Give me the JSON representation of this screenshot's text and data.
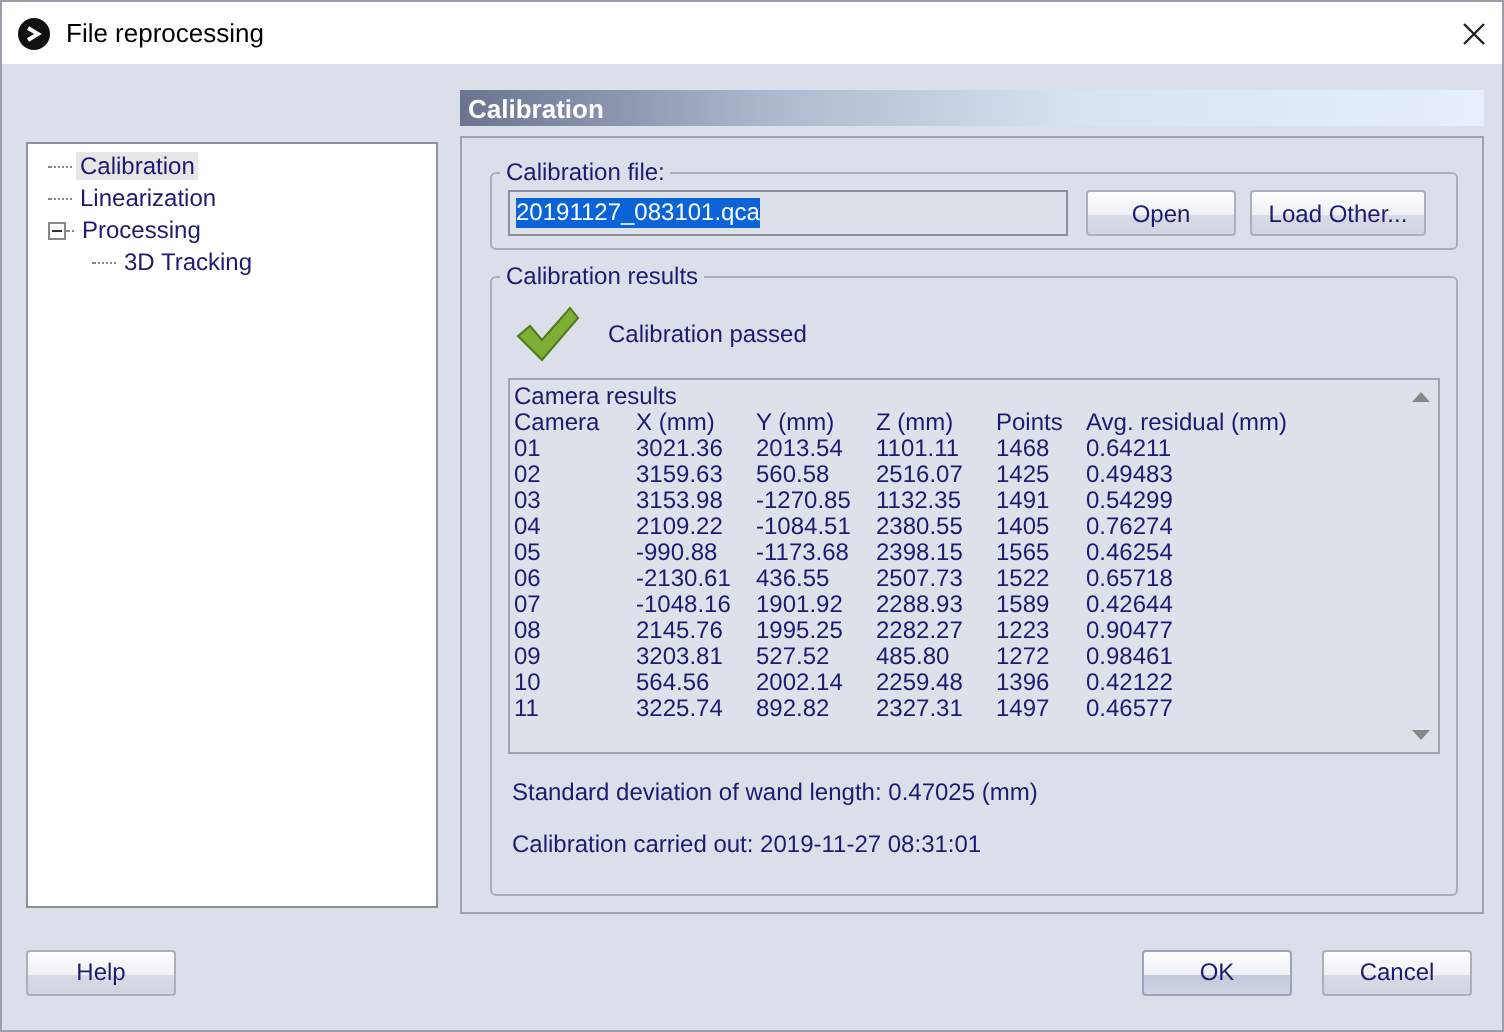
{
  "window": {
    "title": "File reprocessing"
  },
  "tree": [
    {
      "label": "Calibration",
      "selected": true
    },
    {
      "label": "Linearization",
      "selected": false
    },
    {
      "label": "Processing",
      "selected": false,
      "expanded": true,
      "children": [
        {
          "label": "3D Tracking",
          "selected": false
        }
      ]
    }
  ],
  "section_title": "Calibration",
  "calibration_file": {
    "legend": "Calibration file:",
    "value": "20191127_083101.qca",
    "buttons": [
      "Open",
      "Load Other..."
    ]
  },
  "results": {
    "legend": "Calibration results",
    "status": "Calibration passed",
    "passed": true,
    "list_title": "Camera results",
    "columns": [
      "Camera",
      "X (mm)",
      "Y (mm)",
      "Z (mm)",
      "Points",
      "Avg. residual (mm)"
    ],
    "rows": [
      [
        "01",
        "3021.36",
        "2013.54",
        "1101.11",
        "1468",
        "0.64211"
      ],
      [
        "02",
        "3159.63",
        "560.58",
        "2516.07",
        "1425",
        "0.49483"
      ],
      [
        "03",
        "3153.98",
        "-1270.85",
        "1132.35",
        "1491",
        "0.54299"
      ],
      [
        "04",
        "2109.22",
        "-1084.51",
        "2380.55",
        "1405",
        "0.76274"
      ],
      [
        "05",
        "-990.88",
        "-1173.68",
        "2398.15",
        "1565",
        "0.46254"
      ],
      [
        "06",
        "-2130.61",
        "436.55",
        "2507.73",
        "1522",
        "0.65718"
      ],
      [
        "07",
        "-1048.16",
        "1901.92",
        "2288.93",
        "1589",
        "0.42644"
      ],
      [
        "08",
        "2145.76",
        "1995.25",
        "2282.27",
        "1223",
        "0.90477"
      ],
      [
        "09",
        "3203.81",
        "527.52",
        "485.80",
        "1272",
        "0.98461"
      ],
      [
        "10",
        "564.56",
        "2002.14",
        "2259.48",
        "1396",
        "0.42122"
      ],
      [
        "11",
        "3225.74",
        "892.82",
        "2327.31",
        "1497",
        "0.46577"
      ]
    ],
    "wand_label": "Standard deviation of wand length:",
    "wand_value": "0.47025 (mm)",
    "carried_out": "Calibration carried out: 2019-11-27 08:31:01"
  },
  "footer": {
    "left_button": "Help",
    "right_buttons": [
      {
        "label": "OK",
        "default": true
      },
      {
        "label": "Cancel",
        "default": false
      }
    ]
  }
}
